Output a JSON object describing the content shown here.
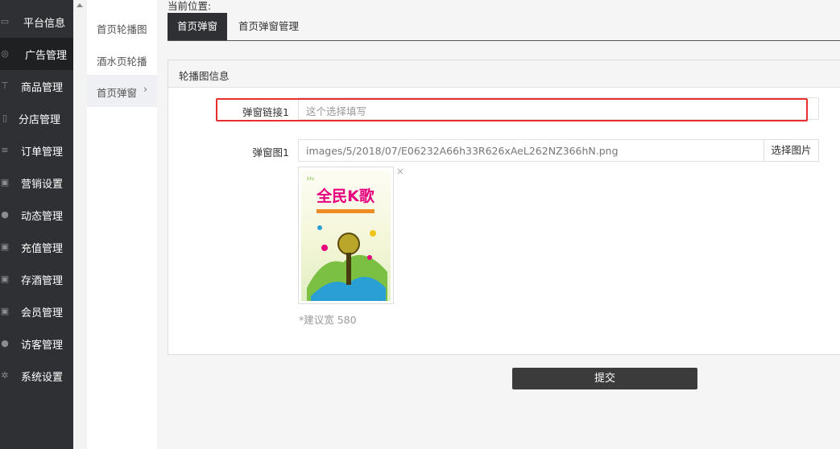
{
  "sidebar": {
    "items": [
      {
        "label": "平台信息",
        "icon": "window-icon"
      },
      {
        "label": "广告管理",
        "icon": "lifebuoy-icon"
      },
      {
        "label": "商品管理",
        "icon": "cart-icon"
      },
      {
        "label": "分店管理",
        "icon": "book-icon"
      },
      {
        "label": "订单管理",
        "icon": "list-icon"
      },
      {
        "label": "营销设置",
        "icon": "gift-icon"
      },
      {
        "label": "动态管理",
        "icon": "user-icon"
      },
      {
        "label": "充值管理",
        "icon": "gift-icon"
      },
      {
        "label": "存酒管理",
        "icon": "gift-icon"
      },
      {
        "label": "会员管理",
        "icon": "gift-icon"
      },
      {
        "label": "访客管理",
        "icon": "user-icon"
      },
      {
        "label": "系统设置",
        "icon": "gear-icon"
      }
    ]
  },
  "submenu": {
    "items": [
      {
        "label": "首页轮播图"
      },
      {
        "label": "酒水页轮播"
      },
      {
        "label": "首页弹窗"
      }
    ]
  },
  "breadcrumb": {
    "label": "当前位置:"
  },
  "tabs": [
    {
      "label": "首页弹窗"
    },
    {
      "label": "首页弹窗管理"
    }
  ],
  "panel": {
    "title": "轮播图信息"
  },
  "form": {
    "link_label": "弹窗链接1",
    "link_placeholder": "这个选择填写",
    "image_label": "弹窗图1",
    "image_value": "images/5/2018/07/E06232A66h33R626xAeL262NZ366hN.png",
    "pick_button": "选择图片",
    "close_symbol": "×",
    "hint": "*建议宽 580",
    "poster_title": "全民K歌"
  },
  "submit_label": "提交",
  "colors": {
    "sidebar_bg": "#2f3033",
    "highlight": "#e4312e",
    "submit_bg": "#3b3b3b"
  }
}
